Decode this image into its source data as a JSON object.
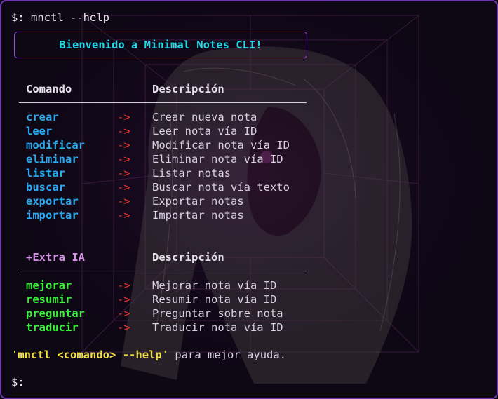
{
  "terminal": {
    "prompt_symbol": "$:",
    "command": "mnctl --help"
  },
  "welcome": "Bienvenido a Minimal Notes CLI!",
  "commands_table": {
    "header_command": "Comando",
    "header_description": "Descripción",
    "arrow": "->",
    "rows": [
      {
        "command": "crear",
        "description": "Crear nueva nota"
      },
      {
        "command": "leer",
        "description": "Leer nota vía ID"
      },
      {
        "command": "modificar",
        "description": "Modificar nota vía ID"
      },
      {
        "command": "eliminar",
        "description": "Eliminar nota vía ID"
      },
      {
        "command": "listar",
        "description": "Listar notas"
      },
      {
        "command": "buscar",
        "description": "Buscar nota vía texto"
      },
      {
        "command": "exportar",
        "description": "Exportar notas"
      },
      {
        "command": "importar",
        "description": "Importar notas"
      }
    ]
  },
  "ai_table": {
    "header_command": "+Extra IA",
    "header_description": "Descripción",
    "arrow": "->",
    "rows": [
      {
        "command": "mejorar",
        "description": "Mejorar nota vía ID"
      },
      {
        "command": "resumir",
        "description": "Resumir nota vía ID"
      },
      {
        "command": "preguntar",
        "description": "Preguntar sobre nota"
      },
      {
        "command": "traducir",
        "description": "Traducir nota vía ID"
      }
    ]
  },
  "help_hint": {
    "quote": "'",
    "cmd": "mnctl",
    "arg": "<comando>",
    "flag": "--help",
    "suffix": " para mejor ayuda."
  },
  "colors": {
    "accent_border": "#6b3aa8",
    "command_blue": "#2aa8f0",
    "command_green": "#3af03a",
    "arrow_red": "#ee3030",
    "welcome_cyan": "#22d9e6"
  }
}
